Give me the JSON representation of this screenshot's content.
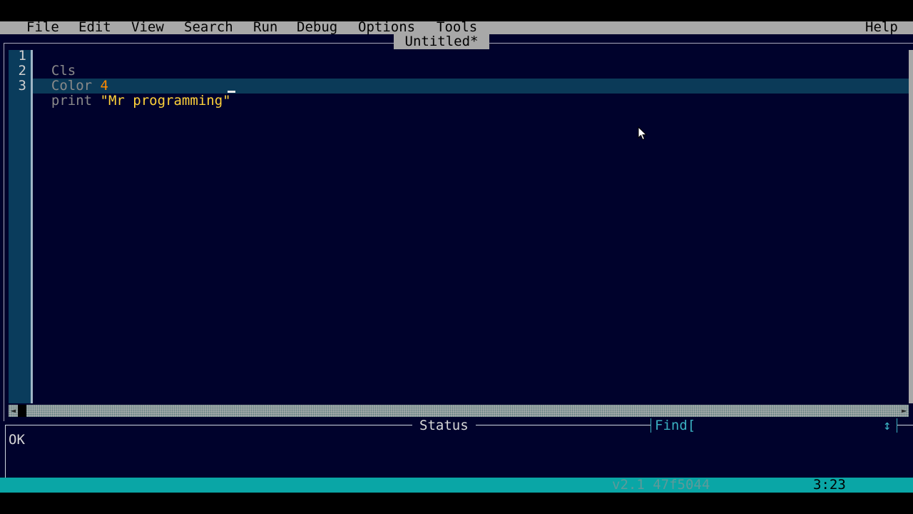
{
  "menu": [
    {
      "label": "File"
    },
    {
      "label": "Edit"
    },
    {
      "label": "View"
    },
    {
      "label": "Search"
    },
    {
      "label": "Run"
    },
    {
      "label": "Debug"
    },
    {
      "label": "Options"
    },
    {
      "label": "Tools"
    },
    {
      "label": "Help"
    }
  ],
  "editor": {
    "tab_title": "Untitled*",
    "lines": [
      {
        "number": "1",
        "keyword": "Cls",
        "arg": ""
      },
      {
        "number": "2",
        "keyword": "Color",
        "arg": "4"
      },
      {
        "number": "3",
        "keyword": "print",
        "arg": "\"Mr programming\""
      }
    ]
  },
  "status": {
    "title": "Status",
    "message": "OK",
    "find_label": "Find[",
    "find_arrow": "↕"
  },
  "bottom": {
    "version": "v2.1 47f5044",
    "position": "3:23"
  },
  "colors": {
    "editor_bg": "#00022c",
    "menu_bg": "#a8a8a8",
    "status_bar_bg": "#0aa6a6",
    "keyword": "#8a8a8a",
    "number": "#ff8a00",
    "string": "#ffd23a"
  }
}
